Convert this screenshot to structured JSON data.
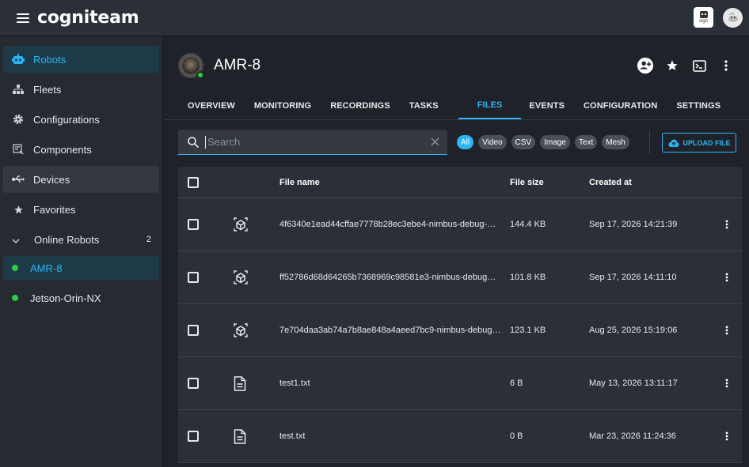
{
  "app": {
    "brand": "cogniteam",
    "sign_label": "sign"
  },
  "sidebar": {
    "items": [
      {
        "label": "Robots",
        "icon": "robot-icon"
      },
      {
        "label": "Fleets",
        "icon": "fleet-icon"
      },
      {
        "label": "Configurations",
        "icon": "gear-icon"
      },
      {
        "label": "Components",
        "icon": "components-icon"
      },
      {
        "label": "Devices",
        "icon": "usb-icon"
      },
      {
        "label": "Favorites",
        "icon": "star-icon"
      }
    ],
    "online_group": {
      "label": "Online Robots",
      "count": "2"
    },
    "robots": [
      {
        "label": "AMR-8"
      },
      {
        "label": "Jetson-Orin-NX"
      }
    ]
  },
  "robot": {
    "name": "AMR-8"
  },
  "tabs": [
    {
      "label": "OVERVIEW"
    },
    {
      "label": "MONITORING"
    },
    {
      "label": "RECORDINGS"
    },
    {
      "label": "TASKS"
    },
    {
      "label": "FILES"
    },
    {
      "label": "EVENTS"
    },
    {
      "label": "CONFIGURATION"
    },
    {
      "label": "SETTINGS"
    }
  ],
  "search": {
    "placeholder": "Search",
    "value": ""
  },
  "filters": [
    {
      "label": "All"
    },
    {
      "label": "Video"
    },
    {
      "label": "CSV"
    },
    {
      "label": "Image"
    },
    {
      "label": "Text"
    },
    {
      "label": "Mesh"
    }
  ],
  "upload_label": "UPLOAD FILE",
  "table": {
    "headers": {
      "name": "File name",
      "size": "File size",
      "created": "Created at"
    },
    "rows": [
      {
        "type": "mesh",
        "name": "4f6340e1ead44cffae7778b28ec3ebe4-nimbus-debug-…",
        "size": "144.4 KB",
        "created": "Sep 17, 2026 14:21:39"
      },
      {
        "type": "mesh",
        "name": "ff52786d68d64265b7368969c98581e3-nimbus-debug…",
        "size": "101.8 KB",
        "created": "Sep 17, 2026 14:11:10"
      },
      {
        "type": "mesh",
        "name": "7e704daa3ab74a7b8ae848a4aeed7bc9-nimbus-debug…",
        "size": "123.1 KB",
        "created": "Aug 25, 2026 15:19:06"
      },
      {
        "type": "text",
        "name": "test1.txt",
        "size": "6 B",
        "created": "May 13, 2026 13:11:17"
      },
      {
        "type": "text",
        "name": "test.txt",
        "size": "0 B",
        "created": "Mar 23, 2026 11:24:36"
      }
    ]
  },
  "colors": {
    "accent": "#29b6f6",
    "online": "#2ecc40",
    "background": "#1f2329"
  }
}
